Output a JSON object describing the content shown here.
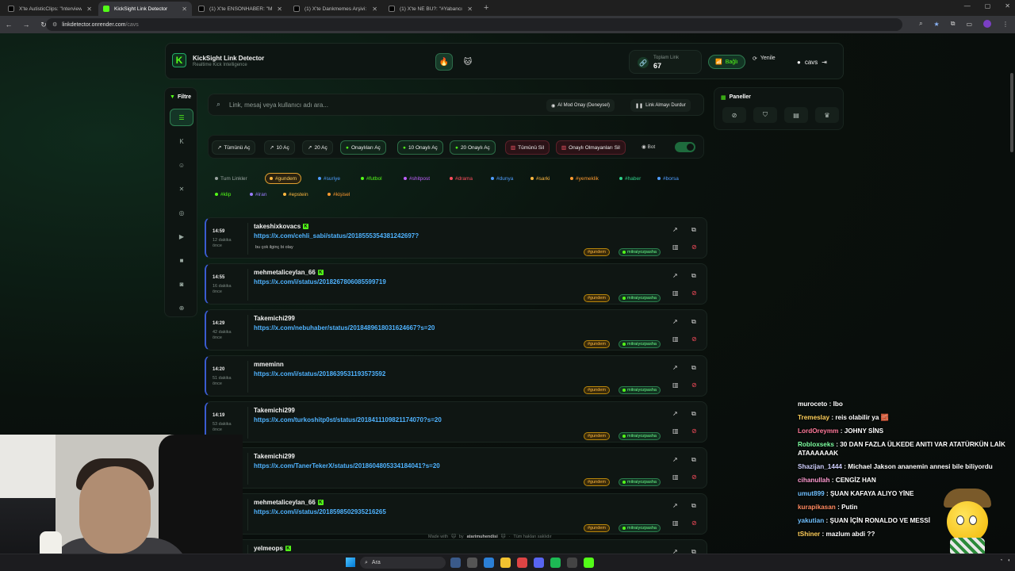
{
  "browser": {
    "tabs": [
      {
        "title": "X'te AutisticClips: \"Interviewer:",
        "fav": "x"
      },
      {
        "title": "KickSight Link Detector",
        "fav": "k",
        "active": true
      },
      {
        "title": "(1) X'te ENSONHABER: \"Michae",
        "fav": "x"
      },
      {
        "title": "(1) X'te Dankmemes Arşivi: \"Tele",
        "fav": "x"
      },
      {
        "title": "(1) X'te NE BU?: \"#Yabancı bir t",
        "fav": "x"
      }
    ],
    "new_tab": "+",
    "url_host": "linkdetector.onrender.com",
    "url_path": "/cavs"
  },
  "header": {
    "logo": "K",
    "title": "KickSight Link Detector",
    "subtitle": "Realtime Kick Intelligence",
    "total_label": "Toplam Link",
    "total_value": "67",
    "connected": "Bağlı",
    "refresh": "Yenile",
    "user": "cavs"
  },
  "sidebar": {
    "filter_label": "Filtre",
    "icons": [
      "list-icon",
      "kick-icon",
      "user-icon",
      "x-icon",
      "instagram-icon",
      "youtube-icon",
      "video-icon",
      "camera-icon",
      "globe-icon"
    ]
  },
  "search": {
    "placeholder": "Link, mesaj veya kullanıcı adı ara...",
    "ai_button": "AI Mod Onay (Deneysel)",
    "stop_button": "Link Almayı Durdur"
  },
  "actions": {
    "open_all": "Tümünü Aç",
    "open_10": "10 Aç",
    "open_20": "20 Aç",
    "open_approved": "Onaylıları Aç",
    "open_10_approved": "10 Onaylı Aç",
    "open_20_approved": "20 Onaylı Aç",
    "delete_all": "Tümünü Sil",
    "delete_unapproved": "Onaylı Olmayanları Sil",
    "bot_label": "Bot",
    "bot_on": true
  },
  "tags": [
    {
      "label": "Tum Linkler",
      "color": "#9aa3a0"
    },
    {
      "label": "#gundem",
      "color": "#ffb840",
      "selected": true
    },
    {
      "label": "#suriye",
      "color": "#4f9dff"
    },
    {
      "label": "#futbol",
      "color": "#53fc18"
    },
    {
      "label": "#shitpost",
      "color": "#c060ff"
    },
    {
      "label": "#drama",
      "color": "#ff4d5e"
    },
    {
      "label": "#dunya",
      "color": "#4f9dff"
    },
    {
      "label": "#sarki",
      "color": "#ffb840"
    },
    {
      "label": "#yemeklik",
      "color": "#ff9a30"
    },
    {
      "label": "#haber",
      "color": "#2fd08a"
    },
    {
      "label": "#borsa",
      "color": "#4f9dff"
    },
    {
      "label": "#klip",
      "color": "#53fc18"
    },
    {
      "label": "#iran",
      "color": "#9a7cff"
    },
    {
      "label": "#epstein",
      "color": "#ffb840"
    },
    {
      "label": "#kişisel",
      "color": "#ff9a30"
    }
  ],
  "panels": {
    "title": "Paneller",
    "icons": [
      "ban-icon",
      "shield-icon",
      "archive-icon",
      "trophy-icon"
    ]
  },
  "feed": [
    {
      "time": "14:59",
      "ago": "12 dakika önce",
      "user": "takeshixkovacs",
      "verified": true,
      "link": "https://x.com/cehli_sabi/status/2018555354381242697?",
      "message": "bu çok ilginç bi olay",
      "tag": "#gundem",
      "mod": "mitraiyozpasha"
    },
    {
      "time": "14:55",
      "ago": "16 dakika önce",
      "user": "mehmetaliceylan_66",
      "verified": true,
      "link": "https://x.com/i/status/2018267806085599719",
      "message": "",
      "tag": "#gundem",
      "mod": "mitraiyozpasha"
    },
    {
      "time": "14:29",
      "ago": "42 dakika önce",
      "user": "Takemichi299",
      "verified": false,
      "link": "https://x.com/nebuhaber/status/2018489618031624667?s=20",
      "message": "",
      "tag": "#gundem",
      "mod": "mitraiyozpasha"
    },
    {
      "time": "14:20",
      "ago": "51 dakika önce",
      "user": "mmeminn",
      "verified": false,
      "link": "https://x.com/i/status/2018639531193573592",
      "message": "",
      "tag": "#gundem",
      "mod": "mitraiyozpasha"
    },
    {
      "time": "14:19",
      "ago": "53 dakika önce",
      "user": "Takemichi299",
      "verified": false,
      "link": "https://x.com/turkoshitp0st/status/2018411109821174070?s=20",
      "message": "",
      "tag": "#gundem",
      "mod": "mitraiyozpasha"
    },
    {
      "time": "",
      "ago": "",
      "user": "Takemichi299",
      "verified": false,
      "link": "https://x.com/TanerTekerX/status/2018604805334184041?s=20",
      "message": "",
      "tag": "#gundem",
      "mod": "mitraiyozpasha"
    },
    {
      "time": "",
      "ago": "",
      "user": "mehmetaliceylan_66",
      "verified": true,
      "link": "https://x.com/i/status/2018598502935216265",
      "message": "",
      "tag": "#gundem",
      "mod": "mitraiyozpasha"
    },
    {
      "time": "",
      "ago": "",
      "user": "yelmeops",
      "verified": true,
      "link": "",
      "message": "",
      "tag": "",
      "mod": ""
    }
  ],
  "footer": {
    "made_with": "Made with",
    "by": "by",
    "author": "atarimuhendisi",
    "rights": "Tüm hakları saklıdır"
  },
  "chat": [
    {
      "user": "muroceto",
      "color": "#ffffff",
      "text": "Ibo"
    },
    {
      "user": "Tremeslay",
      "color": "#ffcf5a",
      "text": "reis olabilir ya 🧱"
    },
    {
      "user": "LordOreymm",
      "color": "#ff7a9a",
      "text": "JOHNY SİNS"
    },
    {
      "user": "Robloxseks",
      "color": "#7dffa0",
      "text": "30 DAN FAZLA ÜLKEDE ANITI VAR ATATÜRKÜN LAİK ATAAAAAAK"
    },
    {
      "user": "Shazijan_1444",
      "color": "#d0d0ff",
      "text": "Michael Jakson ananemin annesi bile biliyordu"
    },
    {
      "user": "cihanullah",
      "color": "#ff9ad0",
      "text": "CENGİZ HAN"
    },
    {
      "user": "umut899",
      "color": "#6fc0ff",
      "text": "ŞUAN KAFAYA ALIYO YİNE"
    },
    {
      "user": "kurapikasan",
      "color": "#ff8a60",
      "text": "Putin"
    },
    {
      "user": "yakutian",
      "color": "#6fc0ff",
      "text": "ŞUAN İÇİN RONALDO VE MESSİ"
    },
    {
      "user": "tShiner",
      "color": "#ffcf5a",
      "text": "mazlum abdi ??"
    }
  ],
  "taskbar": {
    "search_label": "Ara"
  }
}
